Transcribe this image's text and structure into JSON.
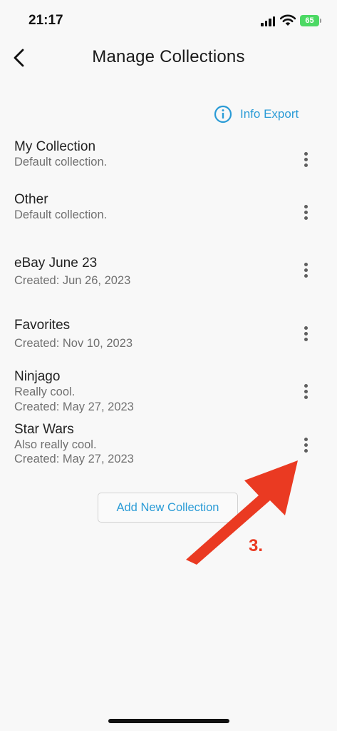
{
  "status_bar": {
    "time": "21:17",
    "battery": "65"
  },
  "header": {
    "title": "Manage Collections"
  },
  "info_export": {
    "label": "Info Export"
  },
  "collections": [
    {
      "name": "My Collection",
      "lines": [
        "Default collection."
      ]
    },
    {
      "name": "Other",
      "lines": [
        "Default collection."
      ]
    },
    {
      "name": "eBay June 23",
      "lines": [
        "Created: Jun 26, 2023"
      ]
    },
    {
      "name": "Favorites",
      "lines": [
        "Created: Nov 10, 2023"
      ]
    },
    {
      "name": "Ninjago",
      "lines": [
        "Really cool.",
        "Created: May 27, 2023"
      ]
    },
    {
      "name": "Star Wars",
      "lines": [
        "Also really cool.",
        "Created: May 27, 2023"
      ]
    }
  ],
  "add_button": {
    "label": "Add New Collection"
  },
  "annotation": {
    "step_label": "3.",
    "color": "#ea3a22"
  },
  "icons": {
    "back": "chevron-left-icon",
    "info": "info-circle-icon",
    "more": "more-vertical-icon"
  },
  "colors": {
    "accent": "#2a9bd6",
    "background": "#f8f8f8",
    "battery": "#4cd964"
  }
}
